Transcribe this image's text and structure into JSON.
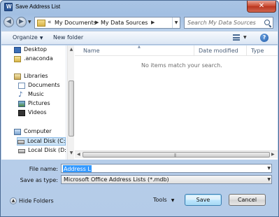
{
  "window": {
    "title": "Save Address List",
    "app_icon_letter": "W"
  },
  "address": {
    "crumbs": [
      "My Documents",
      "My Data Sources"
    ],
    "overflow": "«"
  },
  "search": {
    "placeholder": "Search My Data Sources"
  },
  "toolbar": {
    "organize": "Organize",
    "new_folder": "New folder"
  },
  "nav": {
    "items": [
      {
        "label": "Desktop",
        "icon": "desktop-icon"
      },
      {
        "label": ".anaconda",
        "icon": "folder-icon"
      },
      {
        "label": "Libraries",
        "icon": "libraries-icon"
      },
      {
        "label": "Documents",
        "icon": "documents-icon"
      },
      {
        "label": "Music",
        "icon": "music-icon"
      },
      {
        "label": "Pictures",
        "icon": "pictures-icon"
      },
      {
        "label": "Videos",
        "icon": "videos-icon"
      },
      {
        "label": "Computer",
        "icon": "computer-icon"
      },
      {
        "label": "Local Disk (C:)",
        "icon": "disk-icon"
      },
      {
        "label": "Local Disk (D:)",
        "icon": "disk-icon"
      }
    ]
  },
  "files": {
    "columns": [
      "Name",
      "Date modified",
      "Type"
    ],
    "empty_message": "No items match your search."
  },
  "form": {
    "file_name_label": "File name:",
    "file_name_value": "Address List",
    "save_type_label": "Save as type:",
    "save_type_value": "Microsoft Office Address Lists (*.mdb)"
  },
  "footer": {
    "hide_folders": "Hide Folders",
    "tools": "Tools",
    "save": "Save",
    "cancel": "Cancel"
  },
  "colors": {
    "selection": "#3399ff",
    "chrome": "#b4cbe8"
  }
}
